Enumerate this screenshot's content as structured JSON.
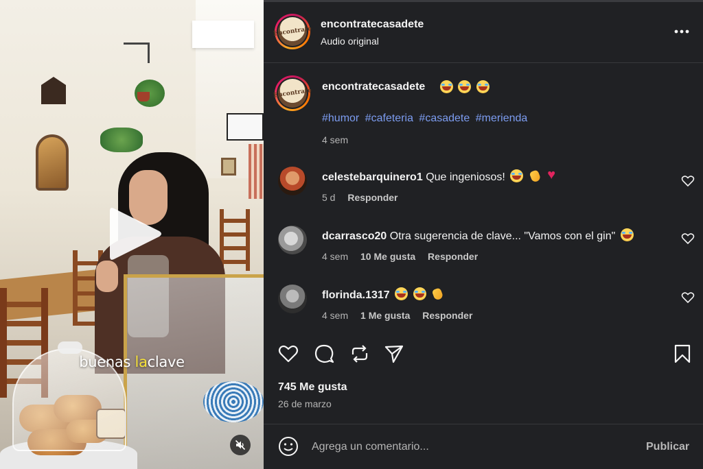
{
  "video": {
    "caption_parts": [
      "buenas",
      "la",
      "clave"
    ],
    "highlight_color": "#f6e23a",
    "icons": [
      "play-icon",
      "muted-speaker-icon"
    ]
  },
  "header": {
    "username": "encontratecasadete",
    "subtitle": "Audio original",
    "avatar_logo_text": "Encontrate",
    "more_icon": "more-horizontal-icon"
  },
  "caption": {
    "username": "encontratecasadete",
    "emojis": [
      "laughing-face",
      "laughing-face",
      "laughing-face"
    ],
    "hashtags": [
      "#humor",
      "#cafeteria",
      "#casadete",
      "#merienda"
    ],
    "time": "4 sem"
  },
  "comments": [
    {
      "username": "celestebarquinero1",
      "text": "Que ingeniosos!",
      "emojis": [
        "laughing-face",
        "clapping-hands",
        "heart"
      ],
      "time": "5 d",
      "likes": "",
      "reply": "Responder"
    },
    {
      "username": "dcarrasco20",
      "text": "Otra sugerencia de clave... \"Vamos con el gin\"",
      "emojis": [
        "laughing-face"
      ],
      "time": "4 sem",
      "likes": "10 Me gusta",
      "reply": "Responder"
    },
    {
      "username": "florinda.1317",
      "text": "",
      "emojis": [
        "laughing-face",
        "laughing-face",
        "clapping-hands"
      ],
      "time": "4 sem",
      "likes": "1 Me gusta",
      "reply": "Responder"
    }
  ],
  "actions": {
    "icons": [
      "heart-icon",
      "comment-icon",
      "repost-icon",
      "share-icon",
      "bookmark-icon"
    ],
    "likes": "745 Me gusta",
    "date": "26 de marzo"
  },
  "add_comment": {
    "placeholder": "Agrega un comentario...",
    "publish": "Publicar"
  },
  "colors": {
    "panel_bg": "#202124",
    "hashtag": "#7c9cf0",
    "muted_text": "#b5b5b5"
  }
}
